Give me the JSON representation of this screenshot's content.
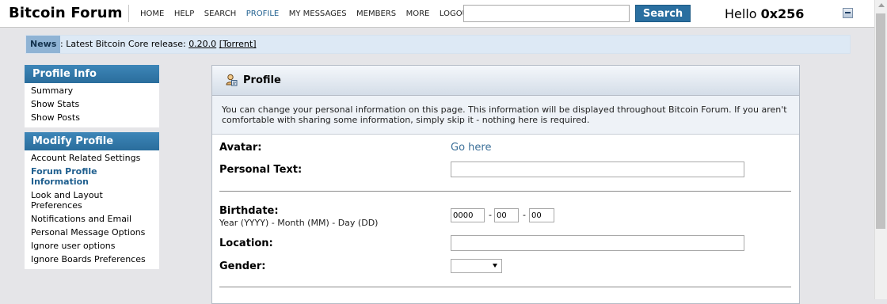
{
  "header": {
    "site_title": "Bitcoin Forum",
    "nav": [
      "HOME",
      "HELP",
      "SEARCH",
      "PROFILE",
      "MY MESSAGES",
      "MEMBERS",
      "MORE",
      "LOGOUT"
    ],
    "active_nav": "PROFILE",
    "search": {
      "value": "",
      "button_label": "Search"
    },
    "greeting": "Hello",
    "username": "0x256"
  },
  "news": {
    "label": "News",
    "text_prefix": ": Latest Bitcoin Core release: ",
    "version_link": "0.20.0",
    "torrent_link": "[Torrent]"
  },
  "sidebar": {
    "profile_info": {
      "title": "Profile Info",
      "items": [
        "Summary",
        "Show Stats",
        "Show Posts"
      ]
    },
    "modify_profile": {
      "title": "Modify Profile",
      "items": [
        "Account Related Settings",
        "Forum Profile Information",
        "Look and Layout Preferences",
        "Notifications and Email",
        "Personal Message Options",
        "Ignore user options",
        "Ignore Boards Preferences"
      ],
      "current": "Forum Profile Information"
    }
  },
  "profile": {
    "title": "Profile",
    "description": "You can change your personal information on this page. This information will be displayed throughout Bitcoin Forum. If you aren't comfortable with sharing some information, simply skip it - nothing here is required.",
    "avatar_label": "Avatar:",
    "avatar_link": "Go here",
    "personal_text_label": "Personal Text:",
    "personal_text_value": "",
    "birthdate_label": "Birthdate:",
    "birthdate_hint": "Year (YYYY) - Month (MM) - Day (DD)",
    "birth_year": "0000",
    "birth_month": "00",
    "birth_day": "00",
    "date_sep": "-",
    "location_label": "Location:",
    "location_value": "",
    "gender_label": "Gender:",
    "gender_value": ""
  }
}
